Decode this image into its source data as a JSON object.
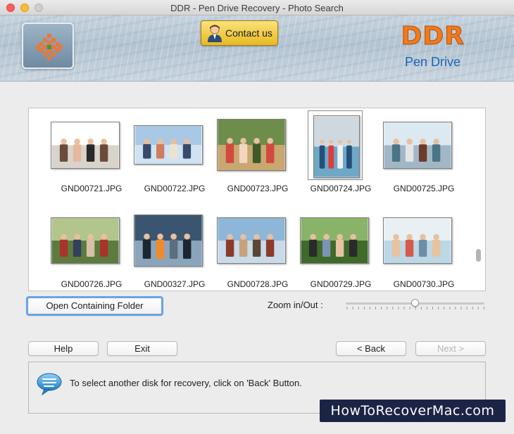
{
  "window": {
    "title": "DDR - Pen Drive Recovery - Photo Search"
  },
  "header": {
    "contact_label": "Contact us",
    "brand": "DDR",
    "brand_sub": "Pen Drive",
    "brand_color": "#f07a1e",
    "sub_color": "#1a64b5"
  },
  "thumbnails": [
    {
      "name": "GND00721.JPG",
      "scene": "family-indoor"
    },
    {
      "name": "GND00722.JPG",
      "scene": "group-beach"
    },
    {
      "name": "GND00723.JPG",
      "scene": "family-park"
    },
    {
      "name": "GND00724.JPG",
      "scene": "group-pier",
      "selected": true
    },
    {
      "name": "GND00725.JPG",
      "scene": "vintage-car"
    },
    {
      "name": "GND00726.JPG",
      "scene": "friends-grass"
    },
    {
      "name": "GND00327.JPG",
      "scene": "campfire-night"
    },
    {
      "name": "GND00728.JPG",
      "scene": "temple-square"
    },
    {
      "name": "GND00729.JPG",
      "scene": "three-men"
    },
    {
      "name": "GND00730.JPG",
      "scene": "boat-party"
    }
  ],
  "controls": {
    "open_folder_label": "Open Containing Folder",
    "zoom_label": "Zoom in/Out :",
    "zoom_level": 0.5,
    "help_label": "Help",
    "exit_label": "Exit",
    "back_label": "< Back",
    "next_label": "Next >"
  },
  "info": {
    "message": "To select another disk for recovery, click on 'Back' Button.",
    "icon": "speech-bubble-icon"
  },
  "watermark": "HowToRecoverMac.com"
}
